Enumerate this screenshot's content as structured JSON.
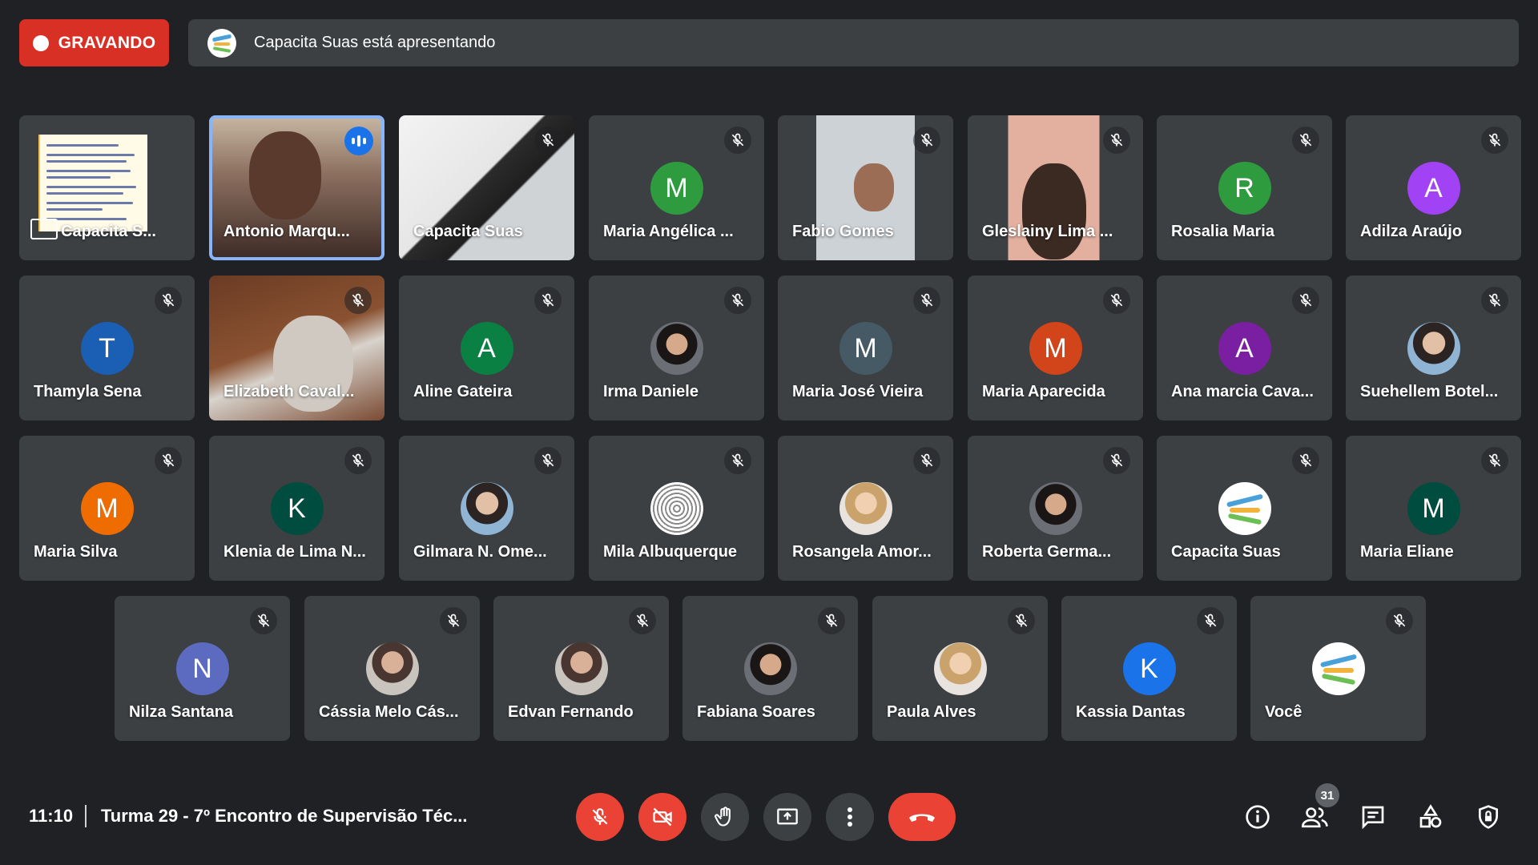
{
  "recording": {
    "label": "GRAVANDO"
  },
  "presenting": {
    "text": "Capacita Suas está apresentando"
  },
  "tiles": [
    {
      "name": "Capacita S..."
    },
    {
      "name": "Antonio Marqu..."
    },
    {
      "name": "Capacita Suas"
    },
    {
      "name": "Maria Angélica ...",
      "initial": "M",
      "color": "#2e9b3e"
    },
    {
      "name": "Fabio Gomes"
    },
    {
      "name": "Gleslainy Lima ..."
    },
    {
      "name": "Rosalia Maria",
      "initial": "R",
      "color": "#2e9b3e"
    },
    {
      "name": "Adilza Araújo",
      "initial": "A",
      "color": "#a142f4"
    },
    {
      "name": "Thamyla Sena",
      "initial": "T",
      "color": "#1a5fb4"
    },
    {
      "name": "Elizabeth Caval..."
    },
    {
      "name": "Aline Gateira",
      "initial": "A",
      "color": "#0b8043"
    },
    {
      "name": "Irma Daniele"
    },
    {
      "name": "Maria José Vieira",
      "initial": "M",
      "color": "#455a64"
    },
    {
      "name": "Maria Aparecida",
      "initial": "M",
      "color": "#d2441a"
    },
    {
      "name": "Ana marcia Cava...",
      "initial": "A",
      "color": "#7b1fa2"
    },
    {
      "name": "Suehellem Botel..."
    },
    {
      "name": "Maria Silva",
      "initial": "M",
      "color": "#ef6c00"
    },
    {
      "name": "Klenia de Lima N...",
      "initial": "K",
      "color": "#004d40"
    },
    {
      "name": "Gilmara N. Ome..."
    },
    {
      "name": "Mila Albuquerque"
    },
    {
      "name": "Rosangela Amor..."
    },
    {
      "name": "Roberta Germa..."
    },
    {
      "name": "Capacita Suas"
    },
    {
      "name": "Maria Eliane",
      "initial": "M",
      "color": "#004d40"
    },
    {
      "name": "Nilza Santana",
      "initial": "N",
      "color": "#5c6bc0"
    },
    {
      "name": "Cássia Melo Cás..."
    },
    {
      "name": "Edvan Fernando"
    },
    {
      "name": "Fabiana Soares"
    },
    {
      "name": "Paula Alves"
    },
    {
      "name": "Kassia Dantas",
      "initial": "K",
      "color": "#1a73e8"
    },
    {
      "name": "Você"
    }
  ],
  "bottom": {
    "time": "11:10",
    "meeting_title": "Turma 29 - 7º Encontro de Supervisão Téc...",
    "participants_count": "31"
  }
}
